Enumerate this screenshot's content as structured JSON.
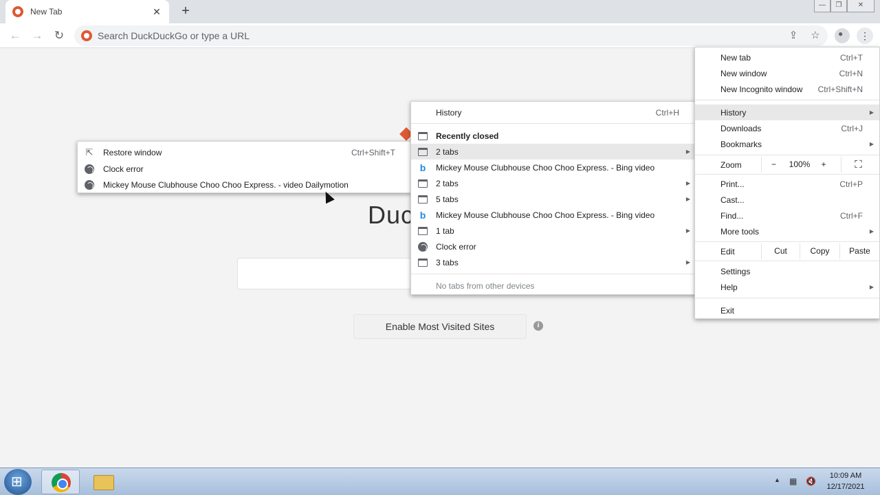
{
  "window": {
    "tab_title": "New Tab",
    "tab_close": "✕",
    "new_tab": "+",
    "minimize": "—",
    "maximize": "❐",
    "close": "✕"
  },
  "toolbar": {
    "back": "←",
    "forward": "→",
    "reload": "↻",
    "omnibox_placeholder": "Search DuckDuckGo or type a URL",
    "share": "⇪",
    "bookmark": "☆",
    "menu": "⋮"
  },
  "page": {
    "logo_text": "Duc",
    "enable_button": "Enable Most Visited Sites",
    "info": "i"
  },
  "recent_submenu": {
    "items": [
      {
        "label": "Restore window",
        "shortcut": "Ctrl+Shift+T",
        "icon": "restore-icon"
      },
      {
        "label": "Clock error",
        "icon": "globe-icon"
      },
      {
        "label": "Mickey Mouse Clubhouse Choo Choo Express. - video Dailymotion",
        "icon": "globe-icon"
      }
    ]
  },
  "history_menu": {
    "history": "History",
    "history_shortcut": "Ctrl+H",
    "recently_closed": "Recently closed",
    "items": [
      {
        "label": "2 tabs",
        "icon": "tabs-icon",
        "submenu": true
      },
      {
        "label": "Mickey Mouse Clubhouse Choo Choo Express. - Bing video",
        "icon": "bing-icon",
        "submenu": false
      },
      {
        "label": "2 tabs",
        "icon": "tabs-icon",
        "submenu": true
      },
      {
        "label": "5 tabs",
        "icon": "tabs-icon",
        "submenu": true
      },
      {
        "label": "Mickey Mouse Clubhouse Choo Choo Express. - Bing video",
        "icon": "bing-icon",
        "submenu": false
      },
      {
        "label": "1 tab",
        "icon": "tabs-icon",
        "submenu": true
      },
      {
        "label": "Clock error",
        "icon": "globe-icon",
        "submenu": false
      },
      {
        "label": "3 tabs",
        "icon": "tabs-icon",
        "submenu": true
      }
    ],
    "no_tabs": "No tabs from other devices"
  },
  "chrome_menu": {
    "new_tab": "New tab",
    "new_tab_sc": "Ctrl+T",
    "new_window": "New window",
    "new_window_sc": "Ctrl+N",
    "incognito": "New Incognito window",
    "incognito_sc": "Ctrl+Shift+N",
    "history": "History",
    "downloads": "Downloads",
    "downloads_sc": "Ctrl+J",
    "bookmarks": "Bookmarks",
    "zoom": "Zoom",
    "zoom_minus": "−",
    "zoom_value": "100%",
    "zoom_plus": "+",
    "print": "Print...",
    "print_sc": "Ctrl+P",
    "cast": "Cast...",
    "find": "Find...",
    "find_sc": "Ctrl+F",
    "more_tools": "More tools",
    "edit": "Edit",
    "cut": "Cut",
    "copy": "Copy",
    "paste": "Paste",
    "settings": "Settings",
    "help": "Help",
    "exit": "Exit"
  },
  "taskbar": {
    "time": "10:09 AM",
    "date": "12/17/2021"
  }
}
